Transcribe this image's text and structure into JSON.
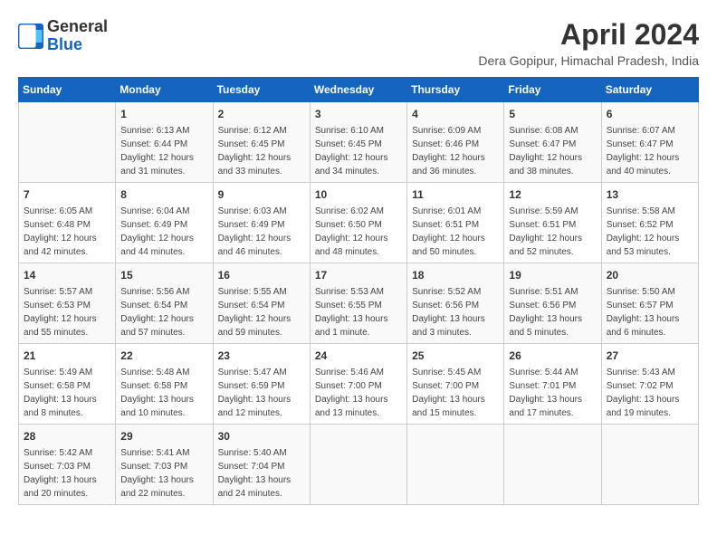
{
  "header": {
    "logo_general": "General",
    "logo_blue": "Blue",
    "month_title": "April 2024",
    "location": "Dera Gopipur, Himachal Pradesh, India"
  },
  "columns": [
    "Sunday",
    "Monday",
    "Tuesday",
    "Wednesday",
    "Thursday",
    "Friday",
    "Saturday"
  ],
  "weeks": [
    [
      {
        "day": "",
        "content": ""
      },
      {
        "day": "1",
        "content": "Sunrise: 6:13 AM\nSunset: 6:44 PM\nDaylight: 12 hours\nand 31 minutes."
      },
      {
        "day": "2",
        "content": "Sunrise: 6:12 AM\nSunset: 6:45 PM\nDaylight: 12 hours\nand 33 minutes."
      },
      {
        "day": "3",
        "content": "Sunrise: 6:10 AM\nSunset: 6:45 PM\nDaylight: 12 hours\nand 34 minutes."
      },
      {
        "day": "4",
        "content": "Sunrise: 6:09 AM\nSunset: 6:46 PM\nDaylight: 12 hours\nand 36 minutes."
      },
      {
        "day": "5",
        "content": "Sunrise: 6:08 AM\nSunset: 6:47 PM\nDaylight: 12 hours\nand 38 minutes."
      },
      {
        "day": "6",
        "content": "Sunrise: 6:07 AM\nSunset: 6:47 PM\nDaylight: 12 hours\nand 40 minutes."
      }
    ],
    [
      {
        "day": "7",
        "content": "Sunrise: 6:05 AM\nSunset: 6:48 PM\nDaylight: 12 hours\nand 42 minutes."
      },
      {
        "day": "8",
        "content": "Sunrise: 6:04 AM\nSunset: 6:49 PM\nDaylight: 12 hours\nand 44 minutes."
      },
      {
        "day": "9",
        "content": "Sunrise: 6:03 AM\nSunset: 6:49 PM\nDaylight: 12 hours\nand 46 minutes."
      },
      {
        "day": "10",
        "content": "Sunrise: 6:02 AM\nSunset: 6:50 PM\nDaylight: 12 hours\nand 48 minutes."
      },
      {
        "day": "11",
        "content": "Sunrise: 6:01 AM\nSunset: 6:51 PM\nDaylight: 12 hours\nand 50 minutes."
      },
      {
        "day": "12",
        "content": "Sunrise: 5:59 AM\nSunset: 6:51 PM\nDaylight: 12 hours\nand 52 minutes."
      },
      {
        "day": "13",
        "content": "Sunrise: 5:58 AM\nSunset: 6:52 PM\nDaylight: 12 hours\nand 53 minutes."
      }
    ],
    [
      {
        "day": "14",
        "content": "Sunrise: 5:57 AM\nSunset: 6:53 PM\nDaylight: 12 hours\nand 55 minutes."
      },
      {
        "day": "15",
        "content": "Sunrise: 5:56 AM\nSunset: 6:54 PM\nDaylight: 12 hours\nand 57 minutes."
      },
      {
        "day": "16",
        "content": "Sunrise: 5:55 AM\nSunset: 6:54 PM\nDaylight: 12 hours\nand 59 minutes."
      },
      {
        "day": "17",
        "content": "Sunrise: 5:53 AM\nSunset: 6:55 PM\nDaylight: 13 hours\nand 1 minute."
      },
      {
        "day": "18",
        "content": "Sunrise: 5:52 AM\nSunset: 6:56 PM\nDaylight: 13 hours\nand 3 minutes."
      },
      {
        "day": "19",
        "content": "Sunrise: 5:51 AM\nSunset: 6:56 PM\nDaylight: 13 hours\nand 5 minutes."
      },
      {
        "day": "20",
        "content": "Sunrise: 5:50 AM\nSunset: 6:57 PM\nDaylight: 13 hours\nand 6 minutes."
      }
    ],
    [
      {
        "day": "21",
        "content": "Sunrise: 5:49 AM\nSunset: 6:58 PM\nDaylight: 13 hours\nand 8 minutes."
      },
      {
        "day": "22",
        "content": "Sunrise: 5:48 AM\nSunset: 6:58 PM\nDaylight: 13 hours\nand 10 minutes."
      },
      {
        "day": "23",
        "content": "Sunrise: 5:47 AM\nSunset: 6:59 PM\nDaylight: 13 hours\nand 12 minutes."
      },
      {
        "day": "24",
        "content": "Sunrise: 5:46 AM\nSunset: 7:00 PM\nDaylight: 13 hours\nand 13 minutes."
      },
      {
        "day": "25",
        "content": "Sunrise: 5:45 AM\nSunset: 7:00 PM\nDaylight: 13 hours\nand 15 minutes."
      },
      {
        "day": "26",
        "content": "Sunrise: 5:44 AM\nSunset: 7:01 PM\nDaylight: 13 hours\nand 17 minutes."
      },
      {
        "day": "27",
        "content": "Sunrise: 5:43 AM\nSunset: 7:02 PM\nDaylight: 13 hours\nand 19 minutes."
      }
    ],
    [
      {
        "day": "28",
        "content": "Sunrise: 5:42 AM\nSunset: 7:03 PM\nDaylight: 13 hours\nand 20 minutes."
      },
      {
        "day": "29",
        "content": "Sunrise: 5:41 AM\nSunset: 7:03 PM\nDaylight: 13 hours\nand 22 minutes."
      },
      {
        "day": "30",
        "content": "Sunrise: 5:40 AM\nSunset: 7:04 PM\nDaylight: 13 hours\nand 24 minutes."
      },
      {
        "day": "",
        "content": ""
      },
      {
        "day": "",
        "content": ""
      },
      {
        "day": "",
        "content": ""
      },
      {
        "day": "",
        "content": ""
      }
    ]
  ]
}
